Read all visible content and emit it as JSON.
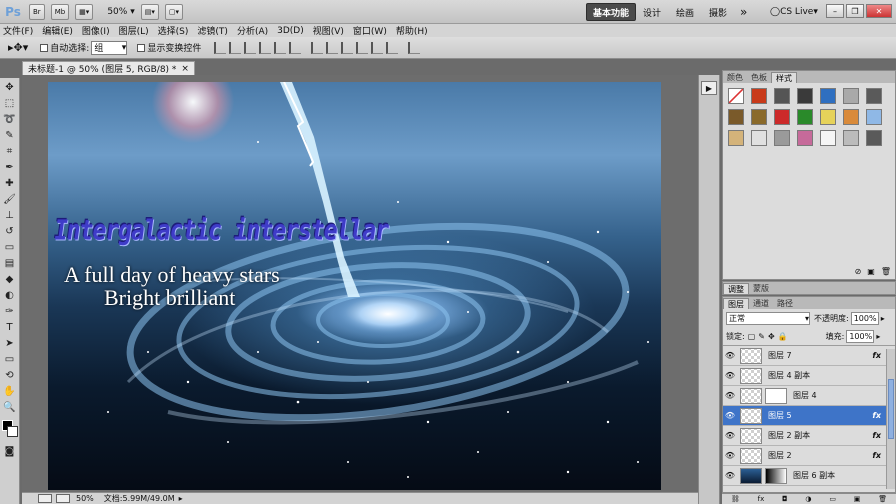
{
  "appbar": {
    "logo": "Ps",
    "br_label": "Br",
    "mb_label": "Mb",
    "zoom": "50%",
    "workspaces": [
      "基本功能",
      "设计",
      "绘画",
      "摄影"
    ],
    "more": "»",
    "cslive": "CS Live"
  },
  "menu": [
    "文件(F)",
    "编辑(E)",
    "图像(I)",
    "图层(L)",
    "选择(S)",
    "滤镜(T)",
    "分析(A)",
    "3D(D)",
    "视图(V)",
    "窗口(W)",
    "帮助(H)"
  ],
  "options": {
    "auto_select_label": "自动选择:",
    "auto_select_value": "组",
    "show_transform_label": "显示变换控件"
  },
  "document": {
    "tab_title": "未标题-1 @ 50% (图层 5, RGB/8) *",
    "close": "×",
    "headline": "Intergalactic interstellar",
    "line1": "A full day of heavy stars",
    "line2": "Bright brilliant"
  },
  "status": {
    "zoom": "50%",
    "doc_size": "文档:5.99M/49.0M"
  },
  "styles_panel": {
    "tabs": [
      "颜色",
      "色板",
      "样式"
    ],
    "active_tab": "样式",
    "swatch_colors": [
      "#ffffff",
      "#c83a1a",
      "#555555",
      "#3a3a3a",
      "#2f6fc0",
      "#a9a9a9",
      "#5a5a5a",
      "#7a5a2a",
      "#8a6a2a",
      "#cc2a2a",
      "#2a8a2a",
      "#e6d25a",
      "#d98a3a",
      "#8fb8e6",
      "#d4b37a",
      "#e0e0e0",
      "#9a9a9a",
      "#c66a9a",
      "#f5f5f5",
      "#bbbbbb",
      "#5a5a5a"
    ]
  },
  "adjust_panel": {
    "tabs": [
      "调整",
      "蒙版"
    ],
    "active_tab": "调整"
  },
  "layers_panel": {
    "tabs": [
      "图层",
      "通道",
      "路径"
    ],
    "active_tab": "图层",
    "blend_mode": "正常",
    "opacity_label": "不透明度:",
    "opacity": "100%",
    "lock_label": "锁定:",
    "fill_label": "填充:",
    "fill": "100%",
    "fx_label": "fx",
    "layers": [
      {
        "name": "图层 7",
        "fx": true,
        "selected": false,
        "mask": false
      },
      {
        "name": "图层 4 副本",
        "fx": false,
        "selected": false,
        "mask": false
      },
      {
        "name": "图层 4",
        "fx": false,
        "selected": false,
        "mask": true
      },
      {
        "name": "图层 5",
        "fx": true,
        "selected": true,
        "mask": false
      },
      {
        "name": "图层 2 副本",
        "fx": true,
        "selected": false,
        "mask": false
      },
      {
        "name": "图层 2",
        "fx": true,
        "selected": false,
        "mask": false
      },
      {
        "name": "图层 6 副本",
        "fx": false,
        "selected": false,
        "mask": true
      }
    ]
  }
}
